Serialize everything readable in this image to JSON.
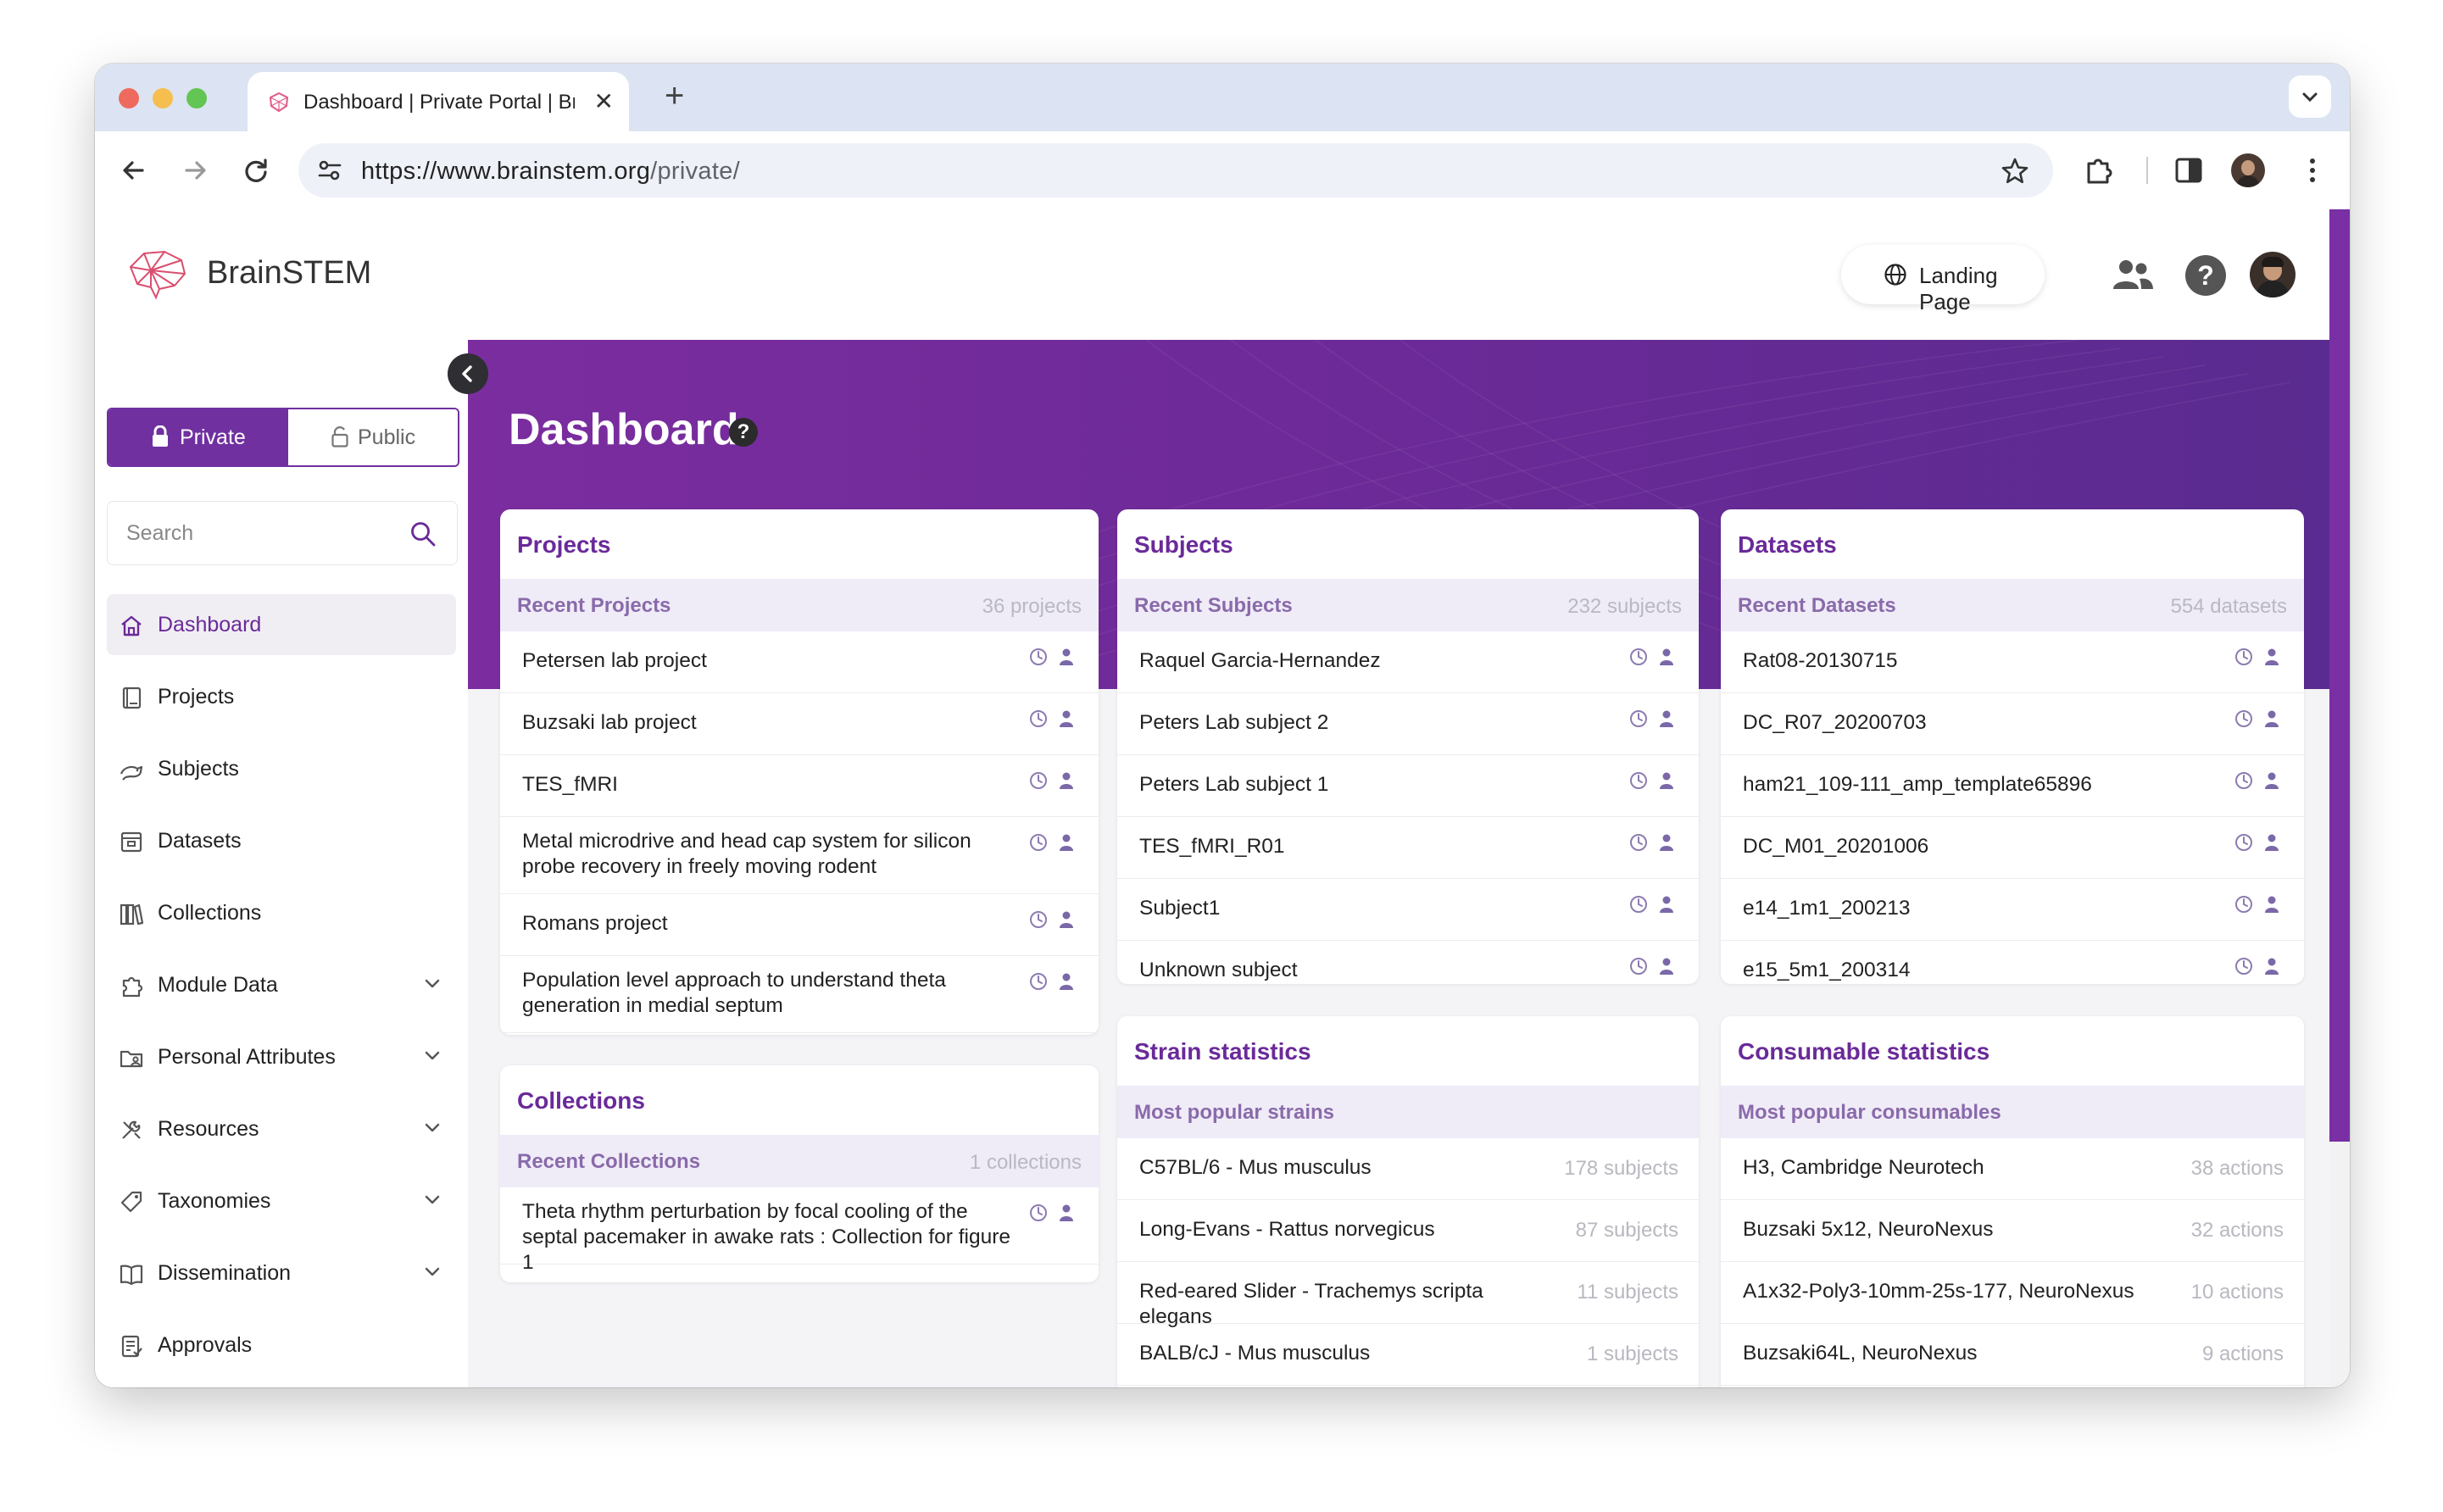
{
  "browser": {
    "tab_title": "Dashboard | Private Portal | BrainSTEM",
    "url_host": "https://www.brainstem.org",
    "url_path": "/private/"
  },
  "app": {
    "brand": "BrainSTEM",
    "landing_label": "Landing Page"
  },
  "sidebar": {
    "private_label": "Private",
    "public_label": "Public",
    "search_placeholder": "Search",
    "items": [
      {
        "label": "Dashboard",
        "icon": "home-icon",
        "active": true,
        "expandable": false
      },
      {
        "label": "Projects",
        "icon": "book-icon",
        "active": false,
        "expandable": false
      },
      {
        "label": "Subjects",
        "icon": "rat-icon",
        "active": false,
        "expandable": false
      },
      {
        "label": "Datasets",
        "icon": "archive-icon",
        "active": false,
        "expandable": false
      },
      {
        "label": "Collections",
        "icon": "library-icon",
        "active": false,
        "expandable": false
      },
      {
        "label": "Module Data",
        "icon": "puzzle-icon",
        "active": false,
        "expandable": true
      },
      {
        "label": "Personal Attributes",
        "icon": "folder-user-icon",
        "active": false,
        "expandable": true
      },
      {
        "label": "Resources",
        "icon": "tools-icon",
        "active": false,
        "expandable": true
      },
      {
        "label": "Taxonomies",
        "icon": "tag-icon",
        "active": false,
        "expandable": true
      },
      {
        "label": "Dissemination",
        "icon": "open-book-icon",
        "active": false,
        "expandable": true
      },
      {
        "label": "Approvals",
        "icon": "checklist-icon",
        "active": false,
        "expandable": false
      }
    ]
  },
  "dashboard": {
    "title": "Dashboard",
    "help_glyph": "?",
    "projects": {
      "title": "Projects",
      "sub_label": "Recent Projects",
      "count": "36 projects",
      "rows": [
        "Petersen lab project",
        "Buzsaki lab project",
        "TES_fMRI",
        "Metal microdrive and head cap system for silicon probe recovery in freely moving rodent",
        "Romans project",
        "Population level approach to understand theta generation in medial septum"
      ]
    },
    "collections": {
      "title": "Collections",
      "sub_label": "Recent Collections",
      "count": "1 collections",
      "rows": [
        "Theta rhythm perturbation by focal cooling of the septal pacemaker in awake rats : Collection for figure 1"
      ]
    },
    "subjects": {
      "title": "Subjects",
      "sub_label": "Recent Subjects",
      "count": "232 subjects",
      "rows": [
        "Raquel Garcia-Hernandez",
        "Peters Lab subject 2",
        "Peters Lab subject 1",
        "TES_fMRI_R01",
        "Subject1",
        "Unknown subject"
      ]
    },
    "datasets": {
      "title": "Datasets",
      "sub_label": "Recent Datasets",
      "count": "554 datasets",
      "rows": [
        "Rat08-20130715",
        "DC_R07_20200703",
        "ham21_109-111_amp_template65896",
        "DC_M01_20201006",
        "e14_1m1_200213",
        "e15_5m1_200314"
      ]
    },
    "strains": {
      "title": "Strain statistics",
      "sub_label": "Most popular strains",
      "rows": [
        {
          "name": "C57BL/6 - Mus musculus",
          "count": "178 subjects"
        },
        {
          "name": "Long-Evans - Rattus norvegicus",
          "count": "87 subjects"
        },
        {
          "name": "Red-eared Slider - Trachemys scripta elegans",
          "count": "11 subjects"
        },
        {
          "name": "BALB/cJ - Mus musculus",
          "count": "1 subjects"
        }
      ]
    },
    "consumables": {
      "title": "Consumable statistics",
      "sub_label": "Most popular consumables",
      "rows": [
        {
          "name": "H3, Cambridge Neurotech",
          "count": "38 actions"
        },
        {
          "name": "Buzsaki 5x12, NeuroNexus",
          "count": "32 actions"
        },
        {
          "name": "A1x32-Poly3-10mm-25s-177, NeuroNexus",
          "count": "10 actions"
        },
        {
          "name": "Buzsaki64L, NeuroNexus",
          "count": "9 actions"
        }
      ]
    }
  },
  "colors": {
    "accent": "#7030a0",
    "hero": "#6d2a98",
    "subheader_bg": "#efecf8"
  }
}
